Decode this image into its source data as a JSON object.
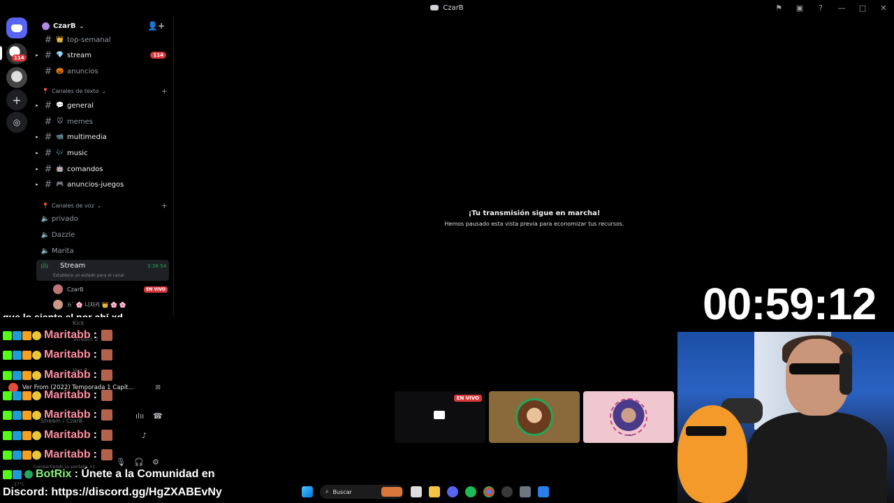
{
  "window": {
    "title": "CzarB"
  },
  "guild": {
    "name": "CzarB"
  },
  "rail": {
    "unread_badge": "114"
  },
  "channels": [
    {
      "name": "top-semanal",
      "emoji": "👑"
    },
    {
      "name": "stream",
      "emoji": "💎",
      "count": "114"
    },
    {
      "name": "anuncios",
      "emoji": "🎃"
    }
  ],
  "text_category": "Canales de texto",
  "text_channels": [
    {
      "name": "general",
      "emoji": "💬"
    },
    {
      "name": "memes",
      "emoji": "🐭"
    },
    {
      "name": "multimedia",
      "emoji": "📹"
    },
    {
      "name": "music",
      "emoji": "🎶"
    },
    {
      "name": "comandos",
      "emoji": "🤖"
    },
    {
      "name": "anuncios-juegos",
      "emoji": "🎮"
    }
  ],
  "voice_category": "Canales de voz",
  "voice_channels": [
    "privado",
    "Dazzle",
    "Marita"
  ],
  "active_voice": {
    "name": "Stream",
    "timer": "3:38:54",
    "status_hint": "Establece un estado para el canal"
  },
  "voice_users": [
    {
      "name": "CzarB",
      "live": "EN VIVO"
    },
    {
      "name": "ℌ` 🌸 니자키 👑 🌸 🌸"
    }
  ],
  "ghost_rows": [
    "Kick",
    "Stream 2",
    "Voz 2"
  ],
  "media": {
    "title": "Ver From (2022) Temporada 1 Capít..."
  },
  "voice_panel": {
    "label": "Stream / CzarB",
    "sharing": "Compartiendo su pantalla +1"
  },
  "notice": {
    "heading": "¡Tu transmisión sigue en marcha!",
    "sub": "Hemos pausado esta vista previa para economizar tus recursos."
  },
  "tiles": {
    "live_label": "EN VIVO"
  },
  "timer": "00:59:12",
  "chat": {
    "cut_line": "que lo siente el por ahí xd",
    "lines": [
      {
        "user": "Maritabb"
      },
      {
        "user": "Maritabb"
      },
      {
        "user": "Maritabb"
      },
      {
        "user": "Maritabb"
      },
      {
        "user": "Maritabb"
      },
      {
        "user": "Maritabb"
      },
      {
        "user": "Maritabb"
      }
    ],
    "bot": {
      "user": "BotRix",
      "message": ": Únete a la Comunidad en",
      "message2": "Discord: https://discord.gg/HgZXABEvNy"
    }
  },
  "taskbar": {
    "search_label": "Buscar",
    "weather": "27°C"
  }
}
